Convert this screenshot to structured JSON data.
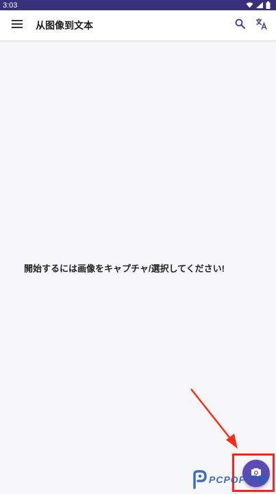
{
  "status_bar": {
    "time": "3:03",
    "icons": [
      "wifi-icon",
      "signal-icon",
      "battery-icon"
    ]
  },
  "app_bar": {
    "title": "从图像到文本",
    "icons": [
      "menu-icon",
      "search-icon",
      "translate-icon"
    ]
  },
  "main": {
    "empty_message": "開始するには画像をキャプチャ/選択してください!"
  },
  "fab": {
    "icon": "camera-icon"
  },
  "watermark": {
    "brand": "PCPOP下载"
  },
  "colors": {
    "status_bar": "#3a2f7a",
    "accent": "#5b4bb7",
    "highlight": "#ff1f1f",
    "background": "#f7f7f9"
  }
}
